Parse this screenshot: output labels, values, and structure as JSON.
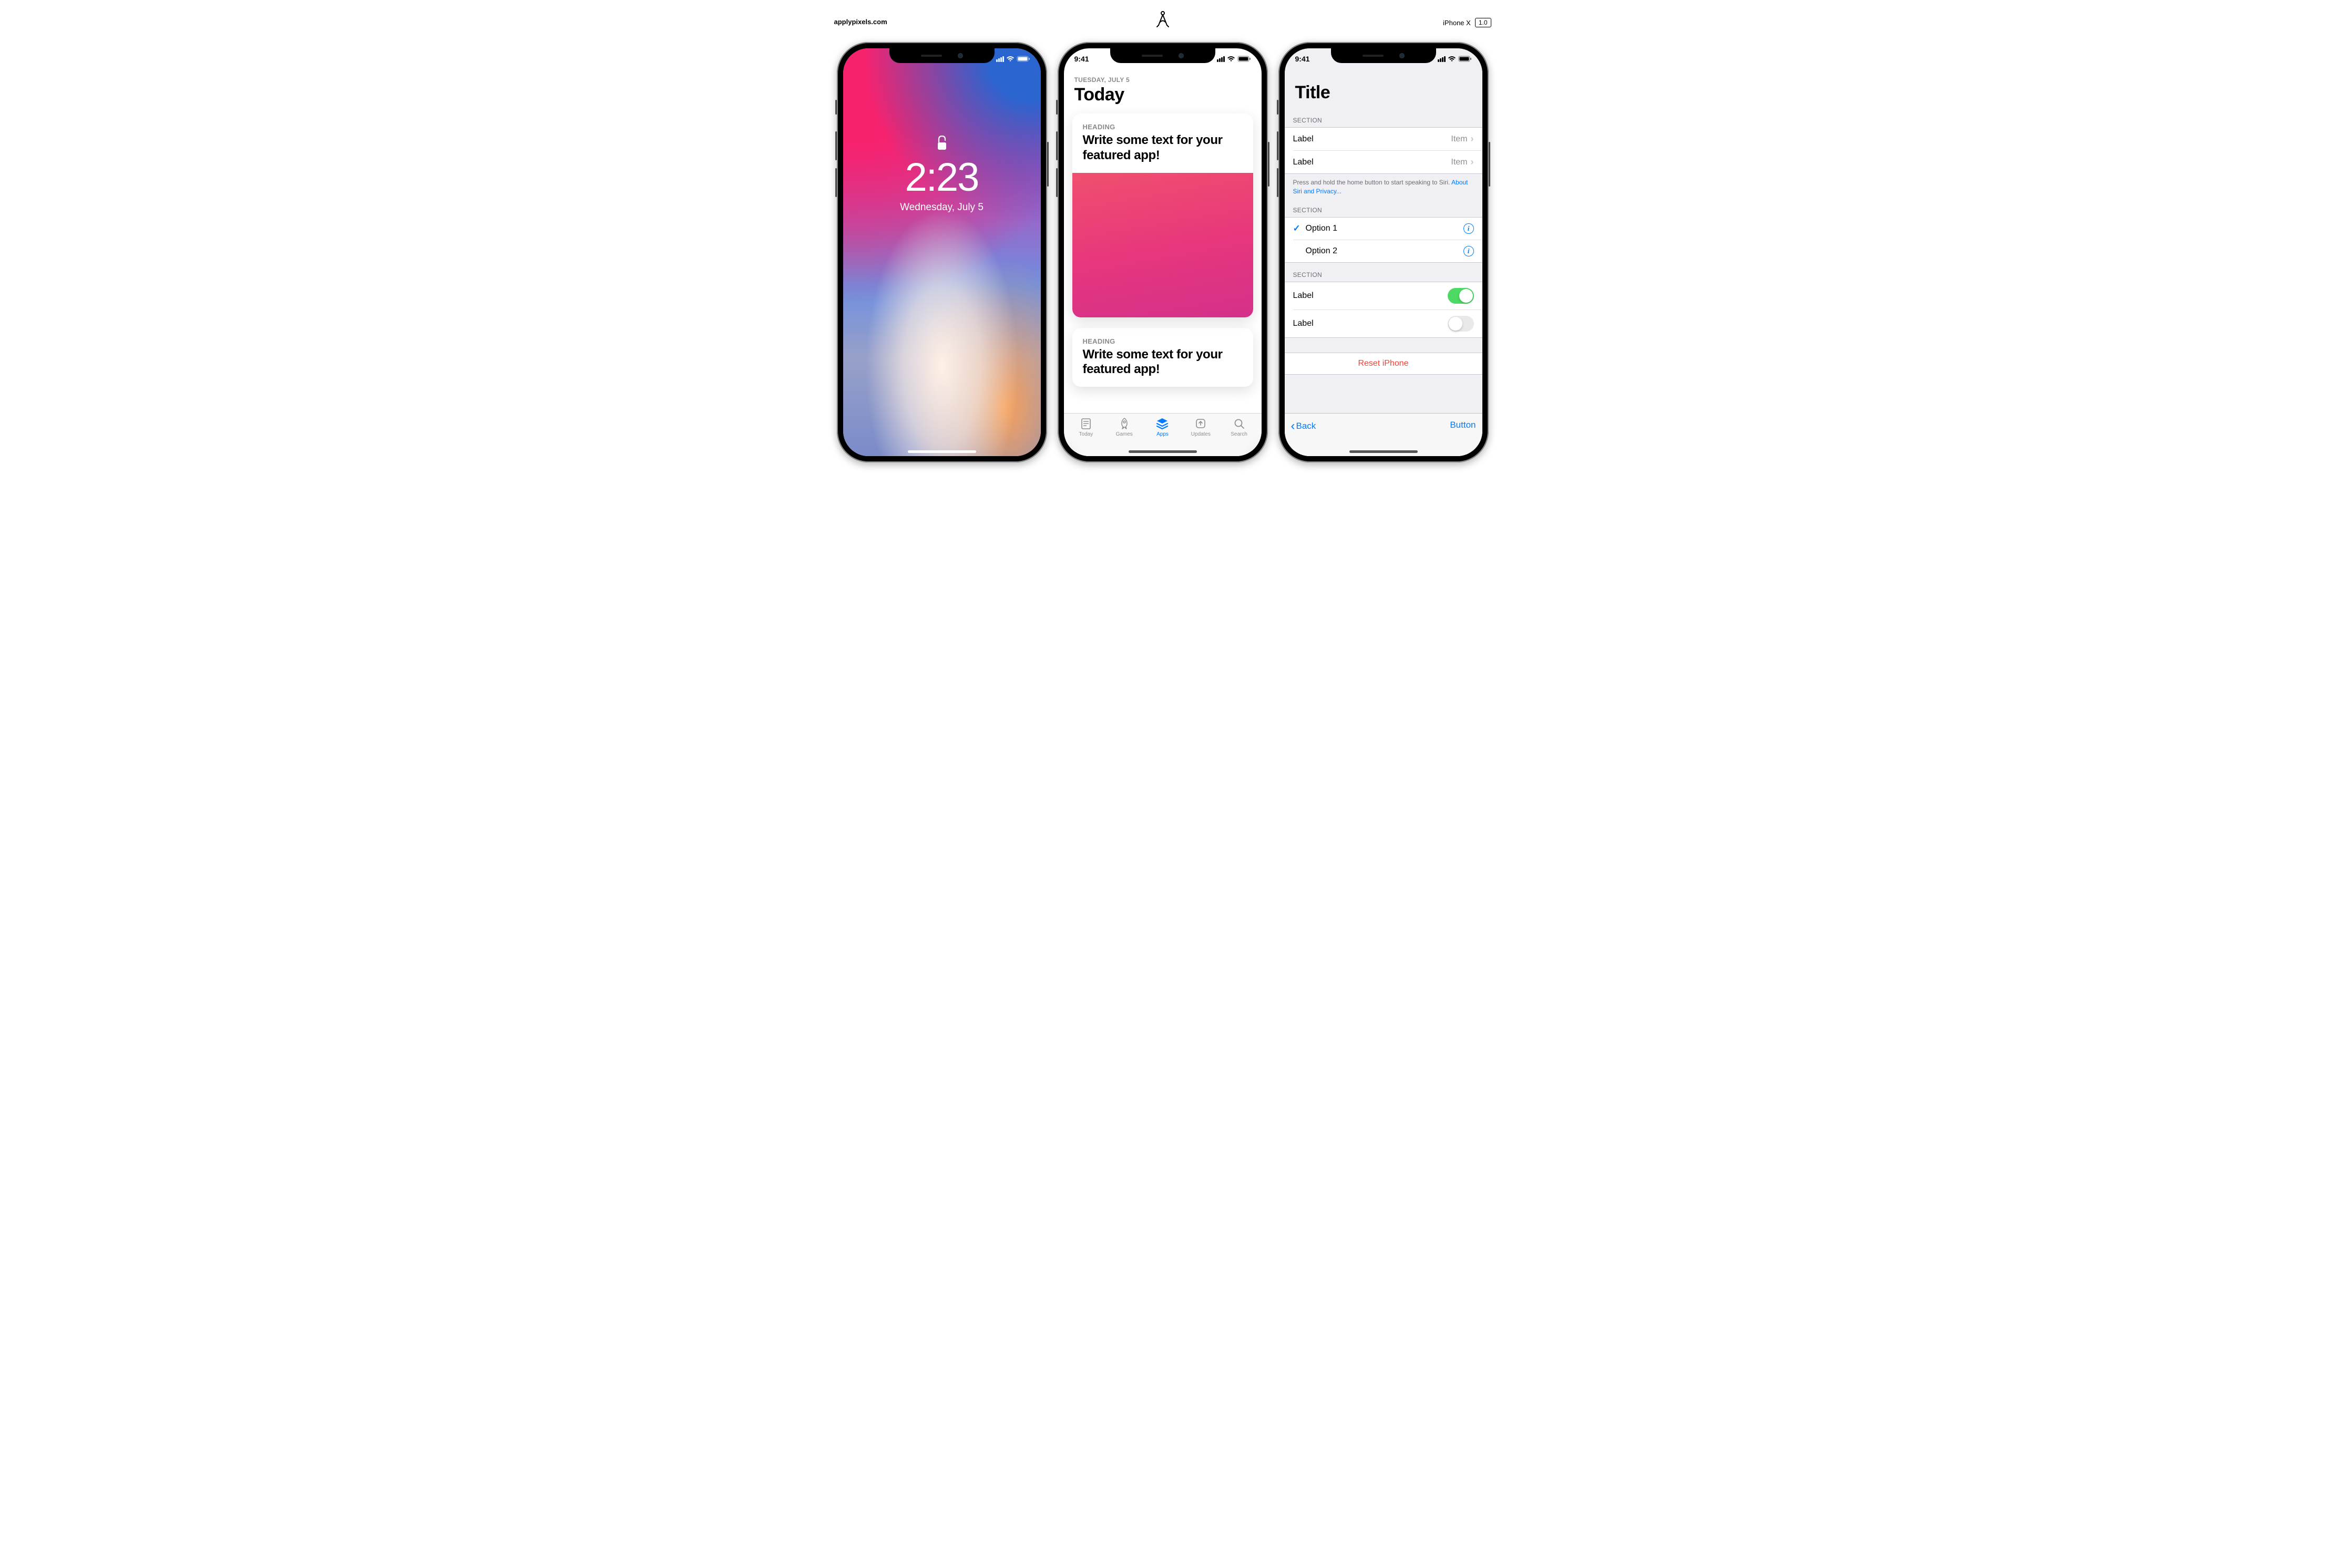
{
  "header": {
    "brand": "applypixels.com",
    "device": "iPhone X",
    "version": "1.0"
  },
  "status": {
    "time_label": "9:41"
  },
  "lock_screen": {
    "time": "2:23",
    "date": "Wednesday, July 5"
  },
  "today_screen": {
    "date_label": "TUESDAY, JULY 5",
    "title": "Today",
    "cards": [
      {
        "heading": "HEADING",
        "body": "Write some text for your featured app!"
      },
      {
        "heading": "HEADING",
        "body": "Write some text for your featured app!"
      }
    ],
    "tabs": [
      {
        "label": "Today",
        "icon": "today",
        "active": false
      },
      {
        "label": "Games",
        "icon": "rocket",
        "active": false
      },
      {
        "label": "Apps",
        "icon": "layers",
        "active": true
      },
      {
        "label": "Updates",
        "icon": "updates",
        "active": false
      },
      {
        "label": "Search",
        "icon": "search",
        "active": false
      }
    ]
  },
  "settings_screen": {
    "title": "Title",
    "sections": {
      "s1": {
        "header": "SECTION",
        "rows": [
          {
            "label": "Label",
            "detail": "Item"
          },
          {
            "label": "Label",
            "detail": "Item"
          }
        ],
        "footer_text": "Press and hold the home button to start speaking to Siri. ",
        "footer_link": "About Siri and Privacy..."
      },
      "s2": {
        "header": "SECTION",
        "options": [
          {
            "label": "Option 1",
            "checked": true
          },
          {
            "label": "Option 2",
            "checked": false
          }
        ]
      },
      "s3": {
        "header": "SECTION",
        "switches": [
          {
            "label": "Label",
            "on": true
          },
          {
            "label": "Label",
            "on": false
          }
        ]
      },
      "s4": {
        "reset_label": "Reset iPhone"
      }
    },
    "toolbar": {
      "back": "Back",
      "button": "Button"
    }
  }
}
